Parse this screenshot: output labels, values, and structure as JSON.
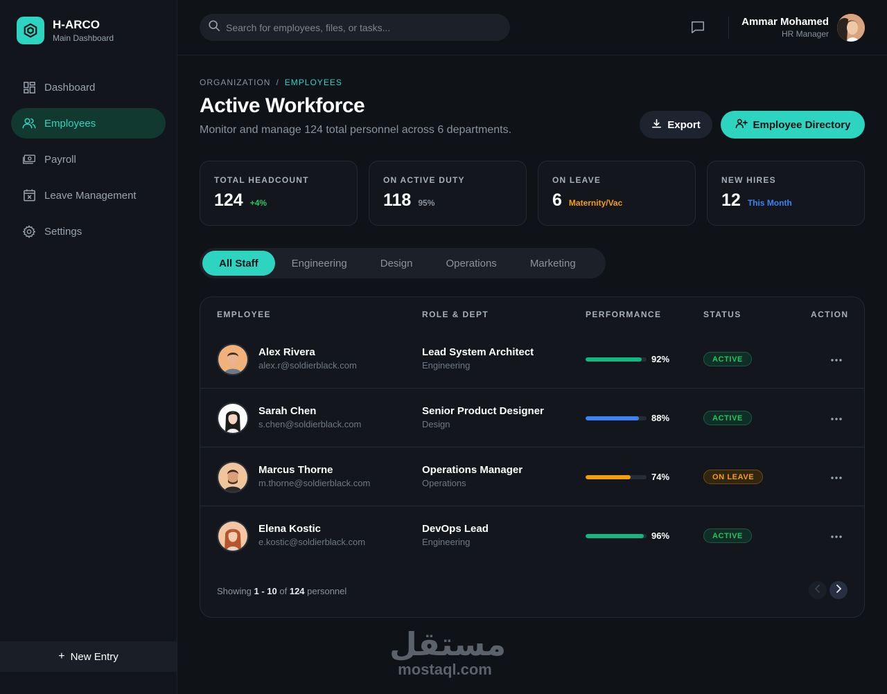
{
  "brand": {
    "title": "H-ARCO",
    "subtitle": "Main Dashboard",
    "accent": "#2dd4bf"
  },
  "sidebar": {
    "items": [
      {
        "label": "Dashboard",
        "icon": "grid-icon",
        "active": false
      },
      {
        "label": "Employees",
        "icon": "users-icon",
        "active": true
      },
      {
        "label": "Payroll",
        "icon": "cash-icon",
        "active": false
      },
      {
        "label": "Leave Management",
        "icon": "calendar-x-icon",
        "active": false
      },
      {
        "label": "Settings",
        "icon": "gear-icon",
        "active": false
      }
    ],
    "new_entry": "New Entry"
  },
  "topbar": {
    "search_placeholder": "Search for employees, files, or tasks...",
    "user": {
      "name": "Ammar Mohamed",
      "role": "HR Manager"
    }
  },
  "page": {
    "breadcrumb": {
      "parent": "ORGANIZATION",
      "sep": "/",
      "current": "EMPLOYEES"
    },
    "title": "Active Workforce",
    "subtitle": "Monitor and manage 124 total personnel across 6 departments.",
    "export_label": "Export",
    "directory_label": "Employee Directory"
  },
  "stats": [
    {
      "label": "TOTAL HEADCOUNT",
      "value": "124",
      "sub": "+4%",
      "sub_color": "#22c55e"
    },
    {
      "label": "ON ACTIVE DUTY",
      "value": "118",
      "sub": "95%",
      "sub_color": "#8a939e"
    },
    {
      "label": "ON LEAVE",
      "value": "6",
      "sub": "Maternity/Vac",
      "sub_color": "#f59e0b"
    },
    {
      "label": "NEW HIRES",
      "value": "12",
      "sub": "This Month",
      "sub_color": "#3b82f6"
    }
  ],
  "tabs": [
    "All Staff",
    "Engineering",
    "Design",
    "Operations",
    "Marketing"
  ],
  "table": {
    "headers": {
      "employee": "EMPLOYEE",
      "role": "ROLE & DEPT",
      "performance": "PERFORMANCE",
      "status": "STATUS",
      "action": "ACTION"
    },
    "rows": [
      {
        "name": "Alex Rivera",
        "email": "alex.r@soldierblack.com",
        "role": "Lead System Architect",
        "dept": "Engineering",
        "perf": 92,
        "perf_label": "92%",
        "perf_color": "#10b981",
        "status": "ACTIVE",
        "status_type": "active"
      },
      {
        "name": "Sarah Chen",
        "email": "s.chen@soldierblack.com",
        "role": "Senior Product Designer",
        "dept": "Design",
        "perf": 88,
        "perf_label": "88%",
        "perf_color": "#3b82f6",
        "status": "ACTIVE",
        "status_type": "active"
      },
      {
        "name": "Marcus Thorne",
        "email": "m.thorne@soldierblack.com",
        "role": "Operations Manager",
        "dept": "Operations",
        "perf": 74,
        "perf_label": "74%",
        "perf_color": "#f59e0b",
        "status": "ON LEAVE",
        "status_type": "leave"
      },
      {
        "name": "Elena Kostic",
        "email": "e.kostic@soldierblack.com",
        "role": "DevOps Lead",
        "dept": "Engineering",
        "perf": 96,
        "perf_label": "96%",
        "perf_color": "#10b981",
        "status": "ACTIVE",
        "status_type": "active"
      }
    ],
    "footer": {
      "prefix": "Showing",
      "range": "1 - 10",
      "of": "of",
      "total": "124",
      "suffix": "personnel"
    }
  },
  "watermark": {
    "arabic": "مستقل",
    "latin": "mostaql.com"
  }
}
